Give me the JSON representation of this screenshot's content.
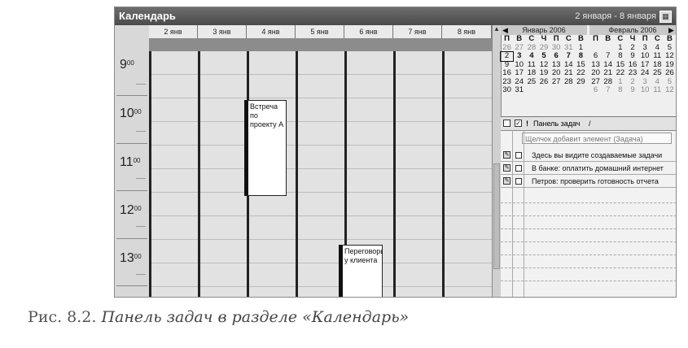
{
  "window": {
    "title": "Календарь",
    "date_range": "2 января - 8 января",
    "calendar_icon": "calendar-icon"
  },
  "days": [
    "2 янв",
    "3 янв",
    "4 янв",
    "5 янв",
    "6 янв",
    "7 янв",
    "8 янв"
  ],
  "hours": [
    {
      "h": "9",
      "m": "00"
    },
    {
      "h": "10",
      "m": "00"
    },
    {
      "h": "11",
      "m": "00"
    },
    {
      "h": "12",
      "m": "00"
    },
    {
      "h": "13",
      "m": "00"
    }
  ],
  "events": [
    {
      "text": "Встреча по проекту А",
      "day": "4 янв"
    },
    {
      "text": "Переговоры у клиента",
      "day": "6 янв"
    }
  ],
  "mini_calendar": {
    "weekdays": [
      "П",
      "В",
      "С",
      "Ч",
      "П",
      "С",
      "В"
    ],
    "months": [
      {
        "title": "Январь 2006",
        "rows": [
          [
            "26",
            "27",
            "28",
            "29",
            "30",
            "31",
            "1"
          ],
          [
            "2",
            "3",
            "4",
            "5",
            "6",
            "7",
            "8"
          ],
          [
            "9",
            "10",
            "11",
            "12",
            "13",
            "14",
            "15"
          ],
          [
            "16",
            "17",
            "18",
            "19",
            "20",
            "21",
            "22"
          ],
          [
            "23",
            "24",
            "25",
            "26",
            "27",
            "28",
            "29"
          ],
          [
            "30",
            "31",
            "",
            "",
            "",
            "",
            ""
          ]
        ]
      },
      {
        "title": "Февраль 2006",
        "rows": [
          [
            "",
            "",
            "1",
            "2",
            "3",
            "4",
            "5"
          ],
          [
            "6",
            "7",
            "8",
            "9",
            "10",
            "11",
            "12"
          ],
          [
            "13",
            "14",
            "15",
            "16",
            "17",
            "18",
            "19"
          ],
          [
            "20",
            "21",
            "22",
            "23",
            "24",
            "25",
            "26"
          ],
          [
            "27",
            "28",
            "1",
            "2",
            "3",
            "4",
            "5"
          ],
          [
            "6",
            "7",
            "8",
            "9",
            "10",
            "11",
            "12"
          ]
        ]
      }
    ]
  },
  "task_panel": {
    "header": "Панель задач",
    "sort_mark": "/",
    "add_placeholder": "Щелчок добавит элемент (Задача)",
    "tasks": [
      "Здесь вы видите создаваемые задачи",
      "В банке: оплатить домашний интернет",
      "Петров: проверить готовность отчета"
    ]
  },
  "caption": {
    "prefix": "Рис. 8.2.",
    "text": "Панель задач в разделе «Календарь»"
  }
}
